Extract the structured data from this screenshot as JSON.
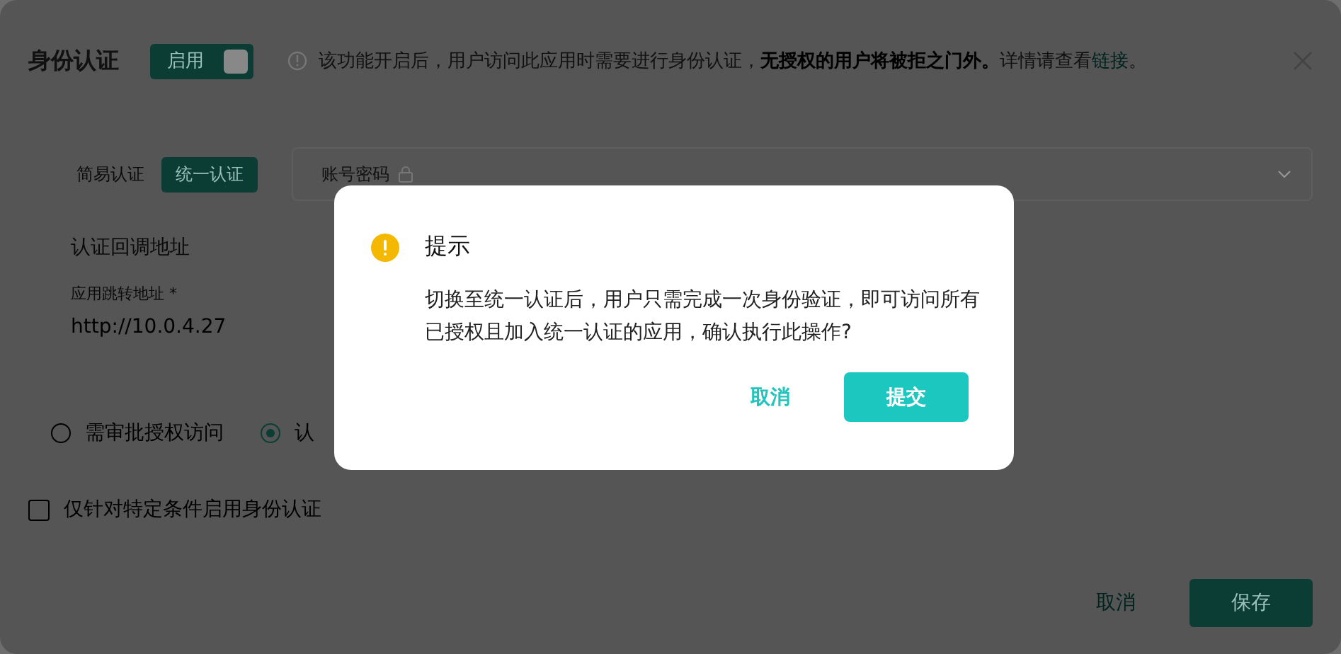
{
  "header": {
    "title": "身份认证",
    "toggle": {
      "label": "启用",
      "on": true
    },
    "notice": {
      "text": "该功能开启后，用户访问此应用时需要进行身份认证，**无授权的用户将被拒之门外。**详情请查看",
      "link": "链接",
      "end": "。"
    }
  },
  "auth_modes": [
    {
      "label": "简易认证",
      "selected": false
    },
    {
      "label": "统一认证",
      "selected": true
    }
  ],
  "method_select": {
    "value": "账号密码"
  },
  "callback": {
    "title": "认证回调地址",
    "field_label": "应用跳转地址",
    "required_mark": "*",
    "value": "http://10.0.4.27"
  },
  "access_modes": [
    {
      "label": "需审批授权访问",
      "selected": false
    },
    {
      "label": "认",
      "selected": true
    }
  ],
  "condition": {
    "label": "仅针对特定条件启用身份认证",
    "checked": false
  },
  "footer": {
    "cancel": "取消",
    "save": "保存"
  },
  "dialog": {
    "title": "提示",
    "message": "切换至统一认证后，用户只需完成一次身份验证，即可访问所有已授权且加入统一认证的应用，确认执行此操作?",
    "cancel": "取消",
    "submit": "提交"
  }
}
